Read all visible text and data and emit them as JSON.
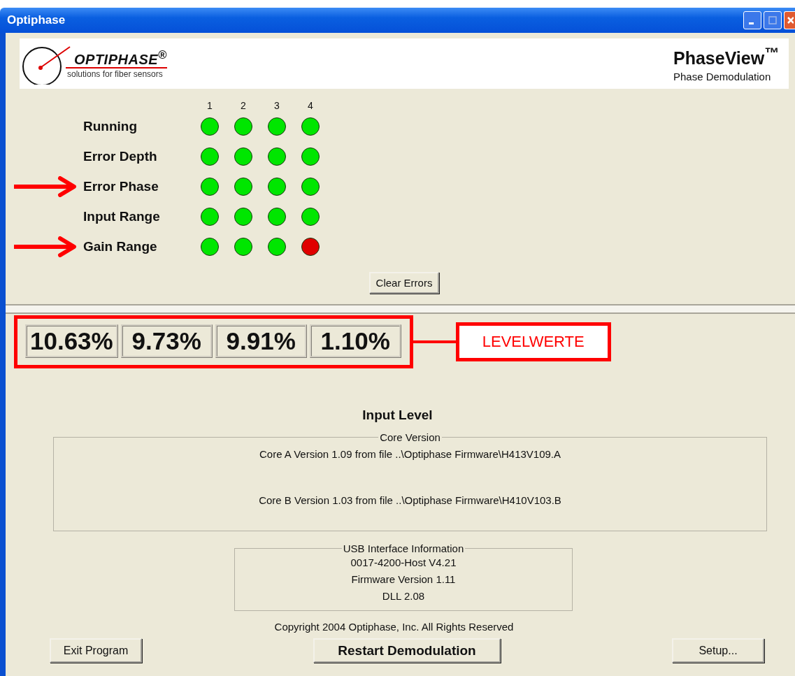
{
  "window": {
    "title": "Optiphase"
  },
  "banner": {
    "logo_name": "OPTIPHASE$^{®}$",
    "logo_tagline": "solutions for fiber sensors",
    "product": "PhaseView$^{™}$",
    "subtitle": "Phase Demodulation"
  },
  "status": {
    "columns": [
      "1",
      "2",
      "3",
      "4"
    ],
    "rows": [
      {
        "label": "Running",
        "marked": false,
        "lights": [
          {
            "color": "#00e600"
          },
          {
            "color": "#00e600"
          },
          {
            "color": "#00e600"
          },
          {
            "color": "#00e600"
          }
        ]
      },
      {
        "label": "Error Depth",
        "marked": false,
        "lights": [
          {
            "color": "#00e600"
          },
          {
            "color": "#00e600"
          },
          {
            "color": "#00e600"
          },
          {
            "color": "#00e600"
          }
        ]
      },
      {
        "label": "Error Phase",
        "marked": true,
        "lights": [
          {
            "color": "#00e600"
          },
          {
            "color": "#00e600"
          },
          {
            "color": "#00e600"
          },
          {
            "color": "#00e600"
          }
        ]
      },
      {
        "label": "Input Range",
        "marked": false,
        "lights": [
          {
            "color": "#00e600"
          },
          {
            "color": "#00e600"
          },
          {
            "color": "#00e600"
          },
          {
            "color": "#00e600"
          }
        ]
      },
      {
        "label": "Gain Range",
        "marked": true,
        "lights": [
          {
            "color": "#00e600"
          },
          {
            "color": "#00e600"
          },
          {
            "color": "#00e600"
          },
          {
            "color": "#e00000"
          }
        ]
      }
    ],
    "clear_button": "Clear Errors"
  },
  "levels": {
    "values": [
      "10.63%",
      "9.73%",
      "9.91%",
      "1.10%"
    ],
    "annotation": "LEVELWERTE",
    "caption": "Input Level"
  },
  "core_version": {
    "title": "Core Version",
    "lines": [
      "Core A Version 1.09 from file ..\\Optiphase Firmware\\H413V109.A",
      "Core B Version 1.03 from file ..\\Optiphase Firmware\\H410V103.B"
    ]
  },
  "usb_info": {
    "title": "USB Interface Information",
    "lines": [
      "0017-4200-Host V4.21",
      "Firmware Version 1.11",
      "DLL 2.08"
    ]
  },
  "copyright": "Copyright 2004 Optiphase, Inc.  All Rights Reserved",
  "buttons": [
    {
      "kind": "plain",
      "label": "Exit Program"
    },
    {
      "kind": "bold",
      "label": "Restart Demodulation"
    },
    {
      "kind": "plain",
      "label": "Setup..."
    }
  ]
}
